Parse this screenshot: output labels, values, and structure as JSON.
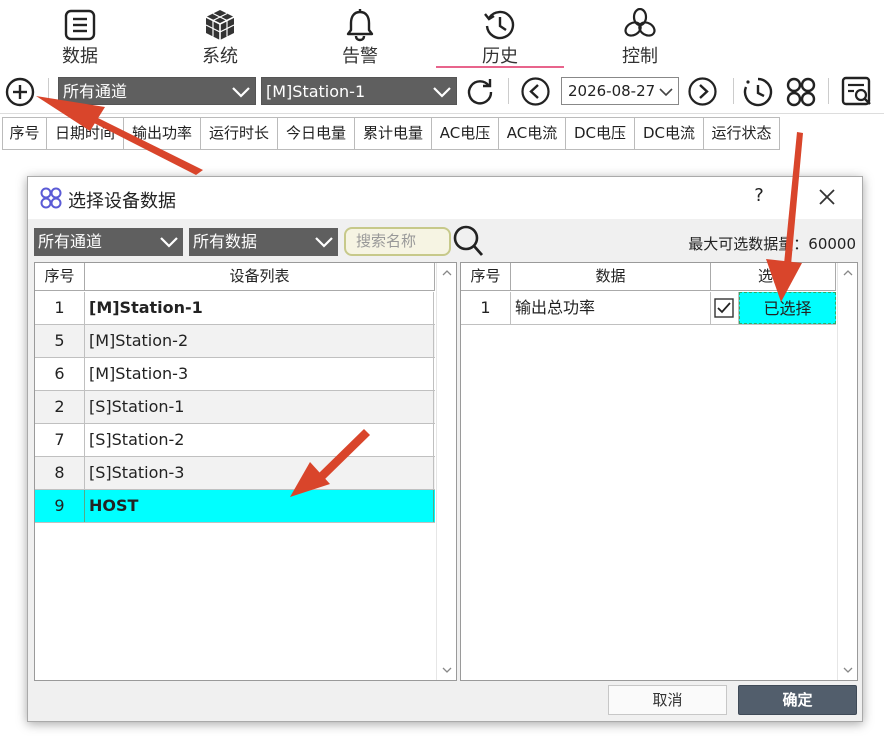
{
  "nav": {
    "items": [
      {
        "label": "数据",
        "icon": "document-list-icon"
      },
      {
        "label": "系统",
        "icon": "cube-icon"
      },
      {
        "label": "告警",
        "icon": "bell-icon"
      },
      {
        "label": "历史",
        "icon": "history-clock-icon",
        "active": true
      },
      {
        "label": "控制",
        "icon": "control-flower-icon"
      }
    ]
  },
  "toolbar": {
    "channel_select": "所有通道",
    "device_select": "[M]Station-1",
    "date": "2026-08-27"
  },
  "table_columns": [
    "序号",
    "日期时间",
    "输出功率",
    "运行时长",
    "今日电量",
    "累计电量",
    "AC电压",
    "AC电流",
    "DC电压",
    "DC电流",
    "运行状态"
  ],
  "dialog": {
    "title": "选择设备数据",
    "help": "?",
    "channel_select": "所有通道",
    "data_select": "所有数据",
    "search_placeholder": "搜索名称",
    "max_label": "最大可选数据量：60000",
    "left": {
      "headers": [
        "序号",
        "设备列表"
      ],
      "rows": [
        {
          "num": "1",
          "name": "[M]Station-1"
        },
        {
          "num": "5",
          "name": "[M]Station-2"
        },
        {
          "num": "6",
          "name": "[M]Station-3"
        },
        {
          "num": "2",
          "name": "[S]Station-1"
        },
        {
          "num": "7",
          "name": "[S]Station-2"
        },
        {
          "num": "8",
          "name": "[S]Station-3"
        },
        {
          "num": "9",
          "name": "HOST"
        }
      ]
    },
    "right": {
      "headers": [
        "序号",
        "数据",
        "选择"
      ],
      "rows": [
        {
          "num": "1",
          "name": "输出总功率",
          "checked": true,
          "status": "已选择"
        }
      ]
    },
    "cancel": "取消",
    "ok": "确定"
  },
  "colors": {
    "selected_row": "#00ffff",
    "accent_underline": "#e8648c",
    "ok_button": "#525e6c",
    "arrow": "#d9452b"
  }
}
